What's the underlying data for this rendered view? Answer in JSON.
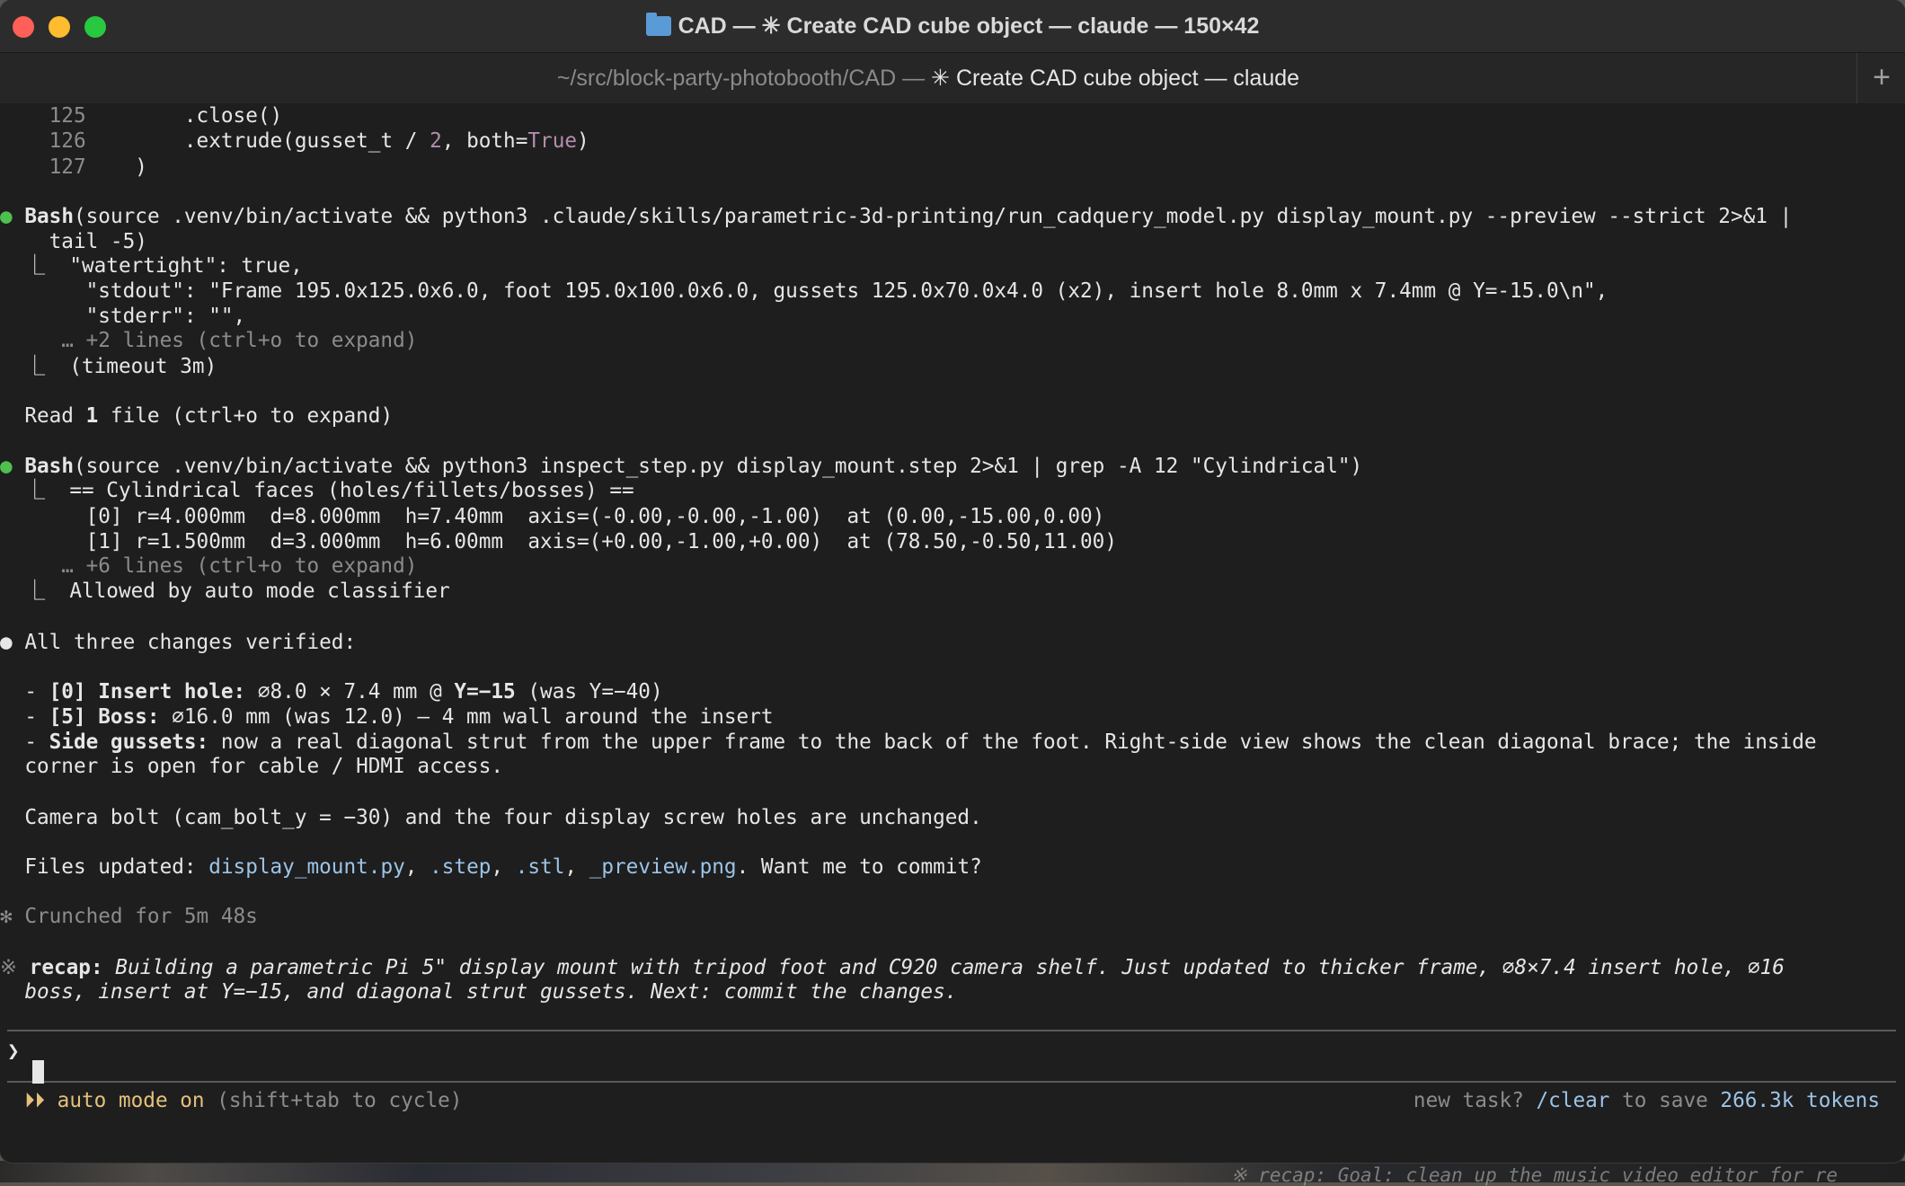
{
  "window": {
    "title_prefix": "CAD — ✳ Create CAD cube object — claude — 150×42",
    "tab_path": "~/src/block-party-photobooth/CAD — ",
    "tab_name": "✳ Create CAD cube object — claude",
    "new_tab": "+"
  },
  "code": [
    {
      "num": "125",
      "text": "        .close()"
    },
    {
      "num": "126",
      "text": "        .extrude(gusset_t / ",
      "n": "2",
      "mid": ", both=",
      "kw": "True",
      "end": ")"
    },
    {
      "num": "127",
      "text": "    )"
    }
  ],
  "bash1": {
    "bullet": "●",
    "tool": "Bash",
    "cmd": "(source .venv/bin/activate && python3 .claude/skills/parametric-3d-printing/run_cadquery_model.py display_mount.py --preview --strict 2>&1 |",
    "cmd2": "    tail -5)",
    "out1": "  ⎿  \"watertight\": true,",
    "out2": "       \"stdout\": \"Frame 195.0x125.0x6.0, foot 195.0x100.0x6.0, gussets 125.0x70.0x4.0 (x2), insert hole 8.0mm x 7.4mm @ Y=-15.0\\n\",",
    "out3": "       \"stderr\": \"\",",
    "more": "     … +2 lines (ctrl+o to expand)",
    "timeout": "  ⎿  (timeout 3m)"
  },
  "read": {
    "pre": "  Read ",
    "count": "1",
    "post": " file (ctrl+o to expand)"
  },
  "bash2": {
    "bullet": "●",
    "tool": "Bash",
    "cmd": "(source .venv/bin/activate && python3 inspect_step.py display_mount.step 2>&1 | grep -A 12 \"Cylindrical\")",
    "out1": "  ⎿  == Cylindrical faces (holes/fillets/bosses) ==",
    "out2": "       [0] r=4.000mm  d=8.000mm  h=7.40mm  axis=(-0.00,-0.00,-1.00)  at (0.00,-15.00,0.00)",
    "out3": "       [1] r=1.500mm  d=3.000mm  h=6.00mm  axis=(+0.00,-1.00,+0.00)  at (78.50,-0.50,11.00)",
    "more": "     … +6 lines (ctrl+o to expand)",
    "allowed": "  ⎿  Allowed by auto mode classifier"
  },
  "summary": {
    "bullet": "●",
    "head": " All three changes verified:",
    "i1_pre": "  - ",
    "i1_b": "[0] Insert hole:",
    "i1_mid": " ⌀8.0 × 7.4 mm @ ",
    "i1_b2": "Y=−15",
    "i1_post": " (was Y=−40)",
    "i2_pre": "  - ",
    "i2_b": "[5] Boss:",
    "i2_post": " ⌀16.0 mm (was 12.0) — 4 mm wall around the insert",
    "i3_pre": "  - ",
    "i3_b": "Side gussets:",
    "i3_post": " now a real diagonal strut from the upper frame to the back of the foot. Right-side view shows the clean diagonal brace; the inside",
    "i3_cont": "  corner is open for cable / HDMI access.",
    "camera": "  Camera bolt (cam_bolt_y = −30) and the four display screw holes are unchanged.",
    "files_pre": "  Files updated: ",
    "file1": "display_mount.py",
    "sep1": ", ",
    "file2": ".step",
    "sep2": ", ",
    "file3": ".stl",
    "sep3": ", ",
    "file4": "_preview.png",
    "files_post": ". Want me to commit?"
  },
  "crunched": "✻ Crunched for 5m 48s",
  "recap": {
    "star": "※ ",
    "label": "recap:",
    "text1": " Building a parametric Pi 5\" display mount with tripod foot and C920 camera shelf. Just updated to thicker frame, ⌀8×7.4 insert hole, ⌀16",
    "text2": "  boss, insert at Y=−15, and diagonal strut gussets. Next: commit the changes."
  },
  "prompt": {
    "symbol": "❯"
  },
  "status": {
    "arrows": "  ⏵⏵ ",
    "mode": "auto mode on",
    "hint": " (shift+tab to cycle)",
    "right_pre": "new task? ",
    "clear": "/clear",
    "right_mid": " to save ",
    "tokens": "266.3k tokens"
  },
  "backdrop_text": "※ recap: Goal: clean up the music video editor for re",
  "colors": {
    "accent_green": "#4ec04e",
    "link_blue": "#9cc4e8",
    "keyword_purple": "#b48ead",
    "mode_yellow": "#e5c07b"
  }
}
